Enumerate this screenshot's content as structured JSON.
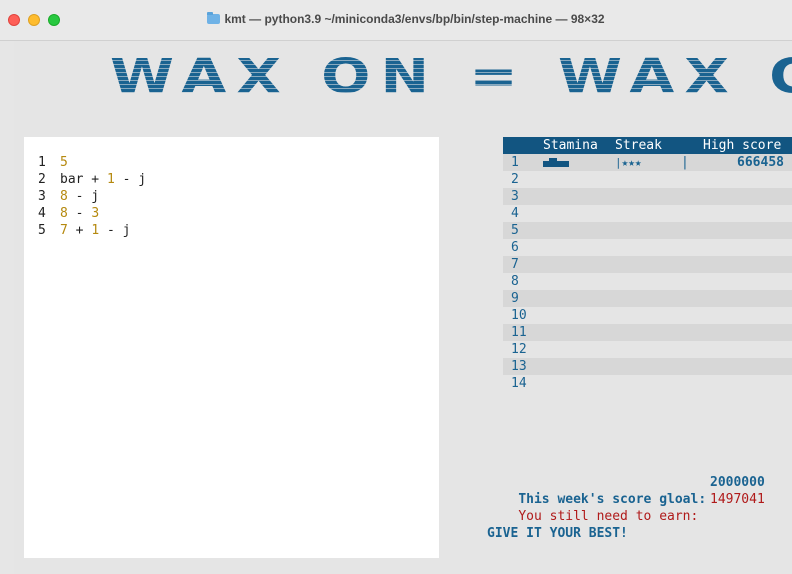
{
  "window": {
    "title": "kmt — python3.9 ~/miniconda3/envs/bp/bin/step-machine — 98×32"
  },
  "banner": {
    "text": "WAX ON = WAX OFF"
  },
  "editor": {
    "lines": [
      {
        "n": "1",
        "parts": [
          {
            "t": "5",
            "num": true
          }
        ]
      },
      {
        "n": "2",
        "parts": [
          {
            "t": "bar + ",
            "num": false
          },
          {
            "t": "1",
            "num": true
          },
          {
            "t": " - j",
            "num": false
          }
        ]
      },
      {
        "n": "3",
        "parts": [
          {
            "t": "8",
            "num": true
          },
          {
            "t": " - j",
            "num": false
          }
        ]
      },
      {
        "n": "4",
        "parts": [
          {
            "t": "8",
            "num": true
          },
          {
            "t": " - ",
            "num": false
          },
          {
            "t": "3",
            "num": true
          }
        ]
      },
      {
        "n": "5",
        "parts": [
          {
            "t": "7",
            "num": true
          },
          {
            "t": " + ",
            "num": false
          },
          {
            "t": "1",
            "num": true
          },
          {
            "t": " - j",
            "num": false
          }
        ]
      }
    ]
  },
  "table": {
    "headers": {
      "stamina": "Stamina",
      "streak": "Streak",
      "high_score": "High score"
    },
    "rows": [
      {
        "idx": "1",
        "streak": "|★★★",
        "streak_end": "|",
        "score": "666458",
        "stamina": true
      },
      {
        "idx": "2"
      },
      {
        "idx": "3"
      },
      {
        "idx": "4"
      },
      {
        "idx": "5"
      },
      {
        "idx": "6"
      },
      {
        "idx": "7"
      },
      {
        "idx": "8"
      },
      {
        "idx": "9"
      },
      {
        "idx": "10"
      },
      {
        "idx": "11"
      },
      {
        "idx": "12"
      },
      {
        "idx": "13"
      },
      {
        "idx": "14"
      }
    ]
  },
  "score": {
    "goal_label": "This week's score gloal:",
    "goal_value": "2000000",
    "need_label": "You still need to earn:",
    "need_value": "1497041",
    "motto": "GIVE IT YOUR BEST!"
  },
  "colors": {
    "accent": "#125581",
    "text_blue": "#1a6391",
    "alert_red": "#b01a1a",
    "number_gold": "#b5890f"
  }
}
